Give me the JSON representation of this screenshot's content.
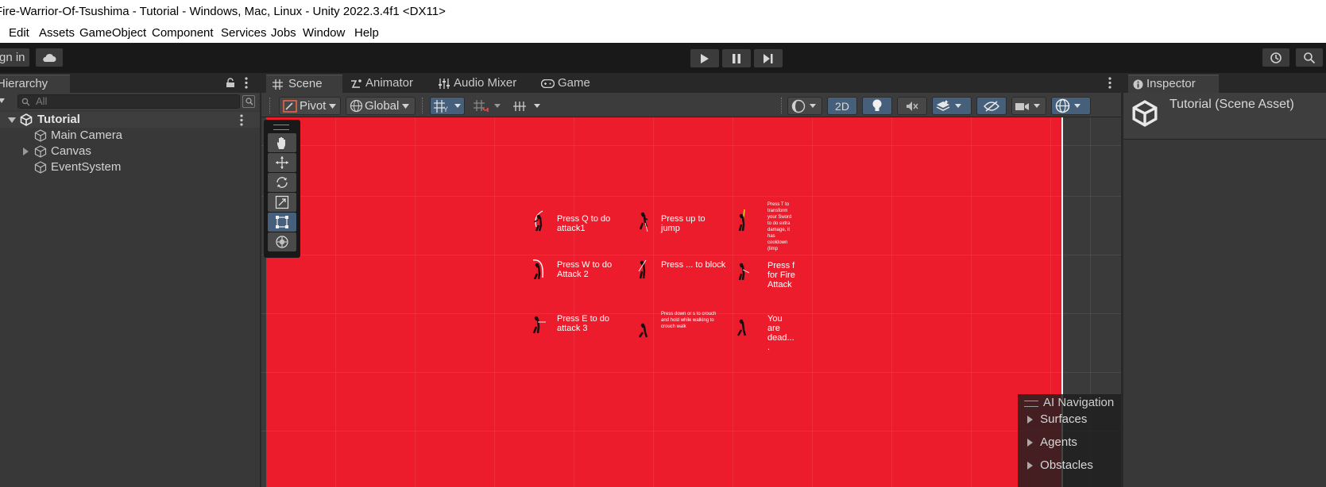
{
  "window": {
    "title": "Fire-Warrior-Of-Tsushima - Tutorial - Windows, Mac, Linux - Unity 2022.3.4f1 <DX11>"
  },
  "menu": [
    "Edit",
    "Assets",
    "GameObject",
    "Component",
    "Services",
    "Jobs",
    "Window",
    "Help"
  ],
  "toolbar": {
    "sign_in": "gn in"
  },
  "hierarchy": {
    "tab": "Hierarchy",
    "search_placeholder": "All",
    "scene": "Tutorial",
    "items": [
      {
        "label": "Main Camera",
        "has_children": false
      },
      {
        "label": "Canvas",
        "has_children": true
      },
      {
        "label": "EventSystem",
        "has_children": false
      }
    ]
  },
  "scene_tabs": [
    {
      "label": "Scene",
      "icon": "grid-icon",
      "active": true
    },
    {
      "label": "Animator",
      "icon": "animator-icon",
      "active": false
    },
    {
      "label": "Audio Mixer",
      "icon": "mixer-icon",
      "active": false
    },
    {
      "label": "Game",
      "icon": "gamepad-icon",
      "active": false
    }
  ],
  "scene_toolbar": {
    "pivot": "Pivot",
    "global": "Global",
    "mode_2d": "2D"
  },
  "tutorial_texts": {
    "q": "Press Q to do attack1",
    "up": "Press up to jump",
    "t": "Press T to transform your Sword to do extra damage, it has cooldown (limp",
    "w": "Press W to do Attack 2",
    "block": "Press ... to block",
    "f": "Press f for Fire Attack",
    "e": "Press E to do attack 3",
    "down": "Press down or s to crouch and hold while walking to crouch walk",
    "dead": "You are dead... ."
  },
  "ai_navigation": {
    "title": "AI Navigation",
    "items": [
      "Surfaces",
      "Agents",
      "Obstacles"
    ]
  },
  "inspector": {
    "tab": "Inspector",
    "asset": "Tutorial (Scene Asset)"
  },
  "colors": {
    "scene_red": "#ed1c2c",
    "accent_blue": "#46607c"
  }
}
